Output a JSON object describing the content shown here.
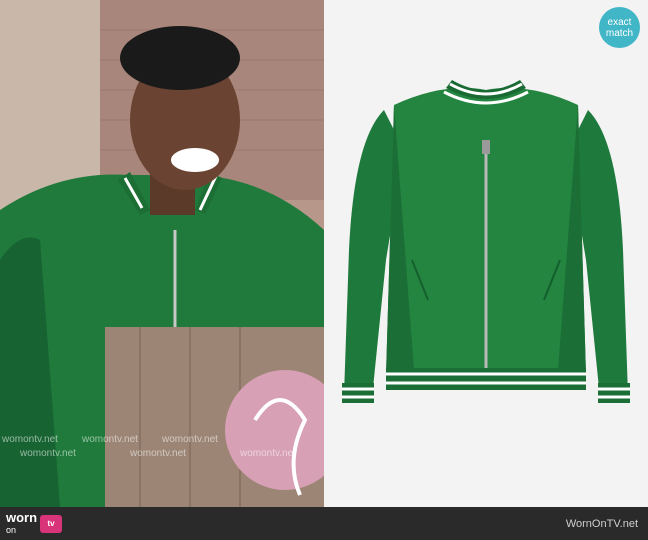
{
  "badge": {
    "line1": "exact",
    "line2": "match"
  },
  "watermarks": [
    "womontv.net",
    "womontv.net",
    "womontv.net",
    "womontv.net",
    "womontv.net",
    "womontv.net"
  ],
  "footer": {
    "logo_word": "worn",
    "logo_on": "on",
    "logo_tv": "tv",
    "site": "WornOnTV.net"
  },
  "colors": {
    "jacket_green": "#1e7a3c",
    "badge_teal": "#41b6c6",
    "footer_bg": "#2a2a2a",
    "logo_pink": "#d9347a"
  }
}
